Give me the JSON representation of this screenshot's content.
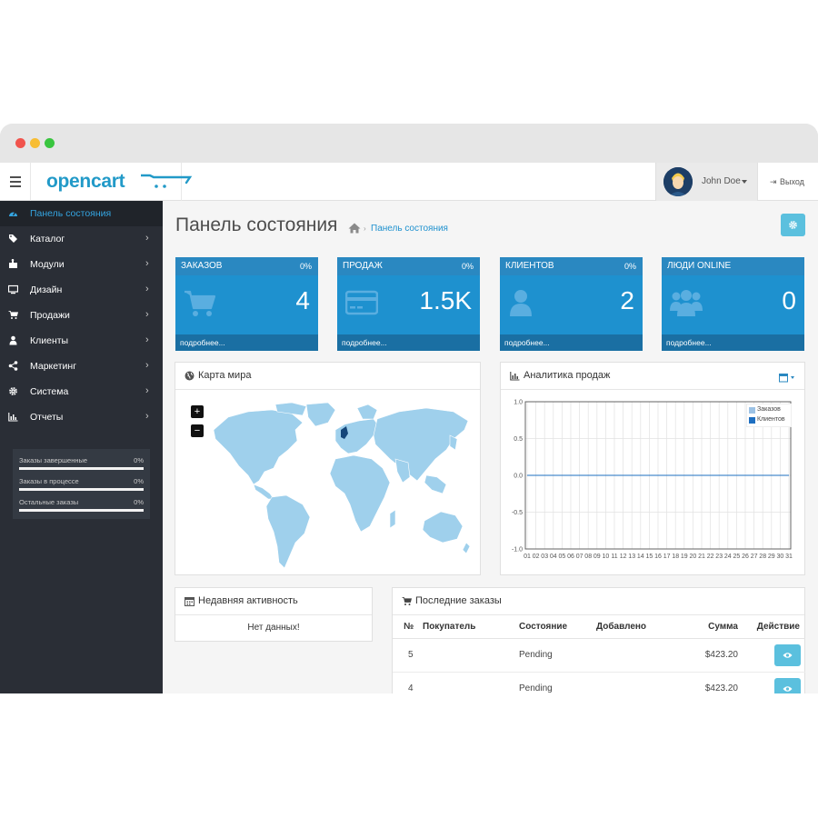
{
  "header": {
    "logo_text": "opencart",
    "user_name": "John Doe",
    "logout_label": "Выход"
  },
  "sidebar": {
    "items": [
      {
        "label": "Панель состояния",
        "icon": "dashboard-icon",
        "active": true
      },
      {
        "label": "Каталог",
        "icon": "tag-icon"
      },
      {
        "label": "Модули",
        "icon": "puzzle-icon"
      },
      {
        "label": "Дизайн",
        "icon": "monitor-icon"
      },
      {
        "label": "Продажи",
        "icon": "cart-icon"
      },
      {
        "label": "Клиенты",
        "icon": "user-icon"
      },
      {
        "label": "Маркетинг",
        "icon": "share-icon"
      },
      {
        "label": "Система",
        "icon": "gear-icon"
      },
      {
        "label": "Отчеты",
        "icon": "bar-chart-icon"
      }
    ],
    "stats": [
      {
        "label": "Заказы завершенные",
        "pct": "0%",
        "progress": 0
      },
      {
        "label": "Заказы в процессе",
        "pct": "0%",
        "progress": 0
      },
      {
        "label": "Остальные заказы",
        "pct": "0%",
        "progress": 0
      }
    ]
  },
  "page": {
    "title": "Панель состояния",
    "breadcrumb": "Панель состояния"
  },
  "tiles": [
    {
      "title": "ЗАКАЗОВ",
      "pct": "0%",
      "value": "4",
      "link": "подробнее...",
      "icon": "cart-icon"
    },
    {
      "title": "ПРОДАЖ",
      "pct": "0%",
      "value": "1.5K",
      "link": "подробнее...",
      "icon": "credit-card-icon"
    },
    {
      "title": "КЛИЕНТОВ",
      "pct": "0%",
      "value": "2",
      "link": "подробнее...",
      "icon": "user-icon"
    },
    {
      "title": "ЛЮДИ ONLINE",
      "pct": "",
      "value": "0",
      "link": "подробнее...",
      "icon": "users-icon"
    }
  ],
  "map_panel": {
    "title": "Карта мира",
    "zoom_in": "+",
    "zoom_out": "−"
  },
  "analytics_panel": {
    "title": "Аналитика продаж"
  },
  "chart_data": {
    "type": "line",
    "x": [
      "01",
      "02",
      "03",
      "04",
      "05",
      "06",
      "07",
      "08",
      "09",
      "10",
      "11",
      "12",
      "13",
      "14",
      "15",
      "16",
      "17",
      "18",
      "19",
      "20",
      "21",
      "22",
      "23",
      "24",
      "25",
      "26",
      "27",
      "28",
      "29",
      "30",
      "31"
    ],
    "series": [
      {
        "name": "Заказов",
        "color": "#9cc2e5",
        "values": [
          0,
          0,
          0,
          0,
          0,
          0,
          0,
          0,
          0,
          0,
          0,
          0,
          0,
          0,
          0,
          0,
          0,
          0,
          0,
          0,
          0,
          0,
          0,
          0,
          0,
          0,
          0,
          0,
          0,
          0,
          0
        ]
      },
      {
        "name": "Клиентов",
        "color": "#1e6fc1",
        "values": [
          0,
          0,
          0,
          0,
          0,
          0,
          0,
          0,
          0,
          0,
          0,
          0,
          0,
          0,
          0,
          0,
          0,
          0,
          0,
          0,
          0,
          0,
          0,
          0,
          0,
          0,
          0,
          0,
          0,
          0,
          0
        ]
      }
    ],
    "yticks": [
      "1.0",
      "0.5",
      "0.0",
      "-0.5",
      "-1.0"
    ],
    "ylim": [
      -1,
      1
    ],
    "grid": true,
    "legend_position": "top-right"
  },
  "activity_panel": {
    "title": "Недавняя активность",
    "empty": "Нет данных!"
  },
  "orders_panel": {
    "title": "Последние заказы",
    "columns": [
      "№",
      "Покупатель",
      "Состояние",
      "Добавлено",
      "Сумма",
      "Действие"
    ],
    "rows": [
      {
        "id": "5",
        "customer": "",
        "status": "Pending",
        "added": "",
        "total": "$423.20"
      },
      {
        "id": "4",
        "customer": "",
        "status": "Pending",
        "added": "",
        "total": "$423.20"
      }
    ]
  }
}
